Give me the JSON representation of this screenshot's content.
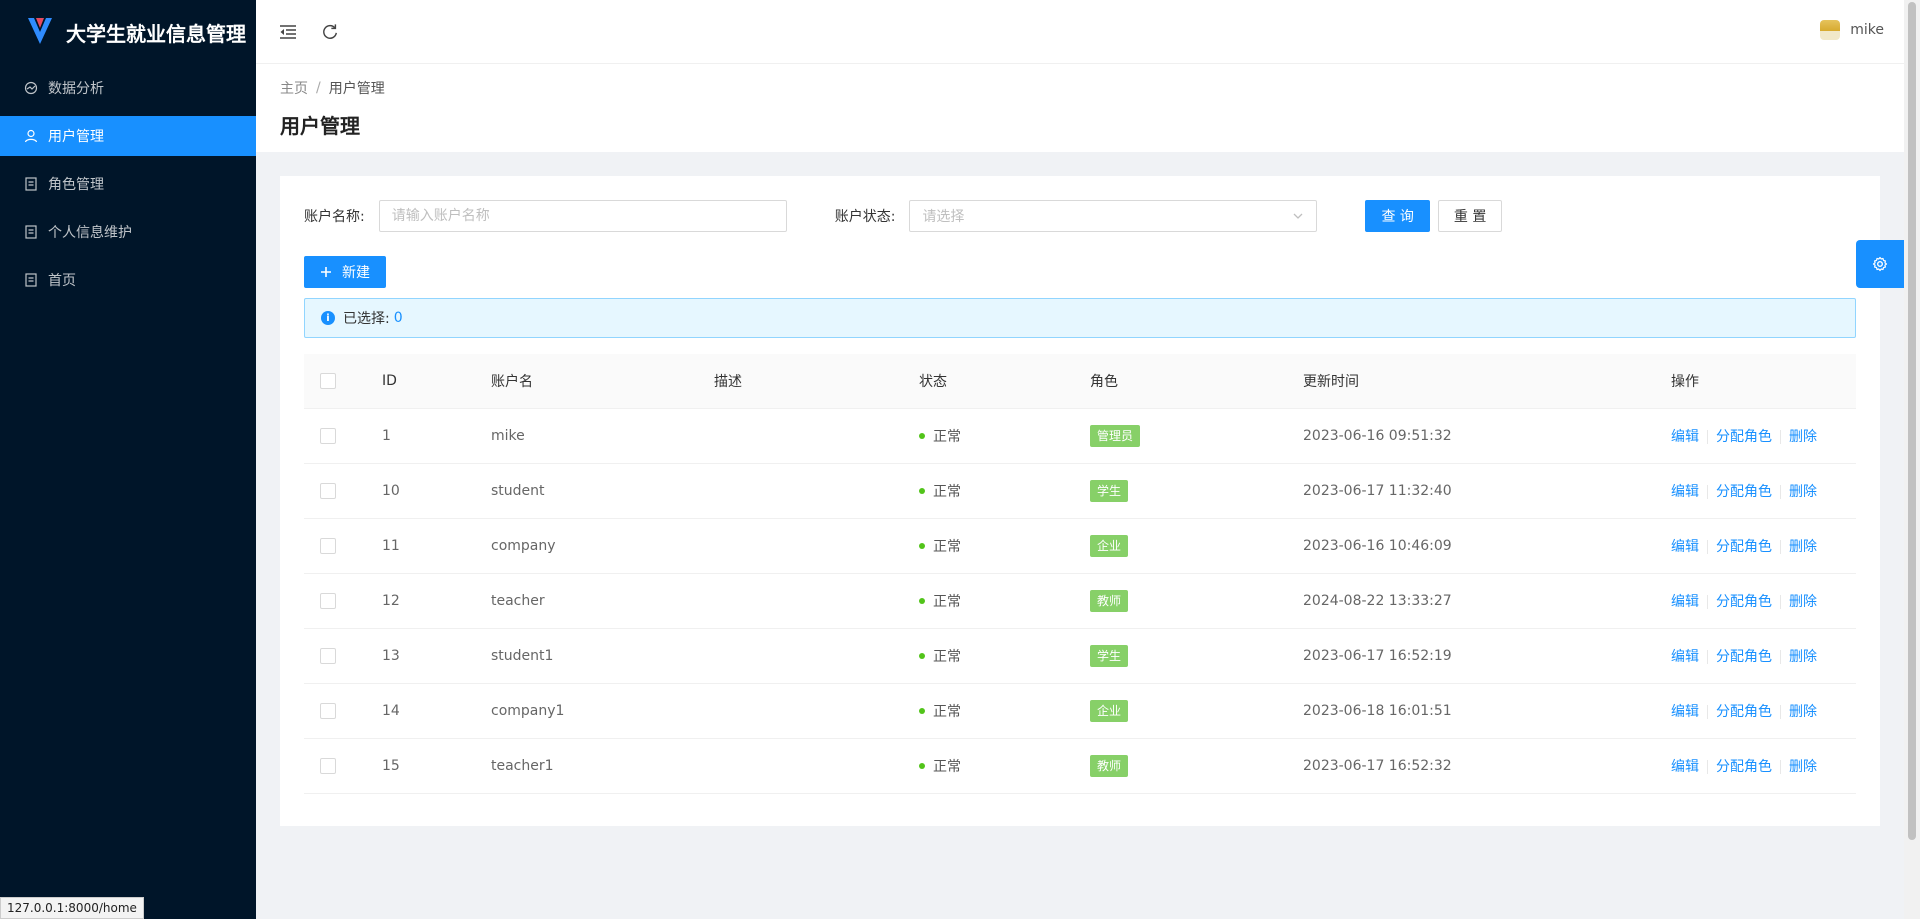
{
  "app": {
    "title": "大学生就业信息管理"
  },
  "sidebar": {
    "items": [
      {
        "label": "数据分析",
        "icon": "data-analysis-icon",
        "active": false
      },
      {
        "label": "用户管理",
        "icon": "user-icon",
        "active": true
      },
      {
        "label": "角色管理",
        "icon": "document-icon",
        "active": false
      },
      {
        "label": "个人信息维护",
        "icon": "document-icon",
        "active": false
      },
      {
        "label": "首页",
        "icon": "document-icon",
        "active": false
      }
    ]
  },
  "statusbar": {
    "url": "127.0.0.1:8000/home"
  },
  "header": {
    "username": "mike"
  },
  "breadcrumb": {
    "home": "主页",
    "separator": "/",
    "current": "用户管理"
  },
  "page": {
    "title": "用户管理"
  },
  "filters": {
    "account_label": "账户名称:",
    "account_placeholder": "请输入账户名称",
    "status_label": "账户状态:",
    "status_placeholder": "请选择",
    "query_label": "查 询",
    "reset_label": "重 置"
  },
  "toolbar": {
    "new_label": "新建"
  },
  "alert": {
    "label": "已选择:",
    "count": "0"
  },
  "table": {
    "columns": [
      "ID",
      "账户名",
      "描述",
      "状态",
      "角色",
      "更新时间",
      "操作"
    ],
    "rows": [
      {
        "id": "1",
        "account": "mike",
        "desc": "",
        "status": "正常",
        "role": "管理员",
        "updated": "2023-06-16 09:51:32"
      },
      {
        "id": "10",
        "account": "student",
        "desc": "",
        "status": "正常",
        "role": "学生",
        "updated": "2023-06-17 11:32:40"
      },
      {
        "id": "11",
        "account": "company",
        "desc": "",
        "status": "正常",
        "role": "企业",
        "updated": "2023-06-16 10:46:09"
      },
      {
        "id": "12",
        "account": "teacher",
        "desc": "",
        "status": "正常",
        "role": "教师",
        "updated": "2024-08-22 13:33:27"
      },
      {
        "id": "13",
        "account": "student1",
        "desc": "",
        "status": "正常",
        "role": "学生",
        "updated": "2023-06-17 16:52:19"
      },
      {
        "id": "14",
        "account": "company1",
        "desc": "",
        "status": "正常",
        "role": "企业",
        "updated": "2023-06-18 16:01:51"
      },
      {
        "id": "15",
        "account": "teacher1",
        "desc": "",
        "status": "正常",
        "role": "教师",
        "updated": "2023-06-17 16:52:32"
      }
    ],
    "ops": {
      "edit": "编辑",
      "assign": "分配角色",
      "delete": "删除"
    }
  },
  "colors": {
    "primary": "#1890ff",
    "sidebar": "#001529",
    "tag": "#87d068",
    "status_ok": "#52c41a"
  }
}
